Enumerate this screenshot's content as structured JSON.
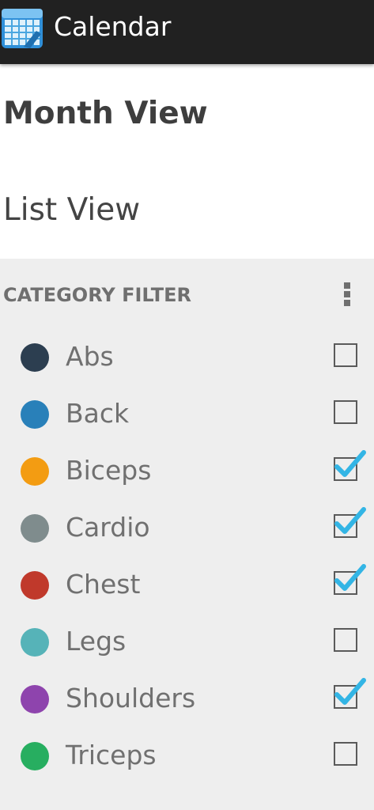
{
  "app": {
    "title": "Calendar",
    "icon": "calendar-app-icon"
  },
  "views": {
    "month_view": "Month View",
    "list_view": "List View"
  },
  "filter": {
    "header": "CATEGORY FILTER",
    "menu_icon": "overflow-menu-icon",
    "categories": [
      {
        "name": "Abs",
        "color": "#2c3e50",
        "checked": false
      },
      {
        "name": "Back",
        "color": "#2980b9",
        "checked": false
      },
      {
        "name": "Biceps",
        "color": "#f39c12",
        "checked": true
      },
      {
        "name": "Cardio",
        "color": "#7f8c8d",
        "checked": true
      },
      {
        "name": "Chest",
        "color": "#c0392b",
        "checked": true
      },
      {
        "name": "Legs",
        "color": "#56b3b8",
        "checked": false
      },
      {
        "name": "Shoulders",
        "color": "#8e44ad",
        "checked": true
      },
      {
        "name": "Triceps",
        "color": "#27ae60",
        "checked": false
      }
    ]
  },
  "colors": {
    "action_bar": "#212121",
    "checkmark": "#33b5e5"
  }
}
